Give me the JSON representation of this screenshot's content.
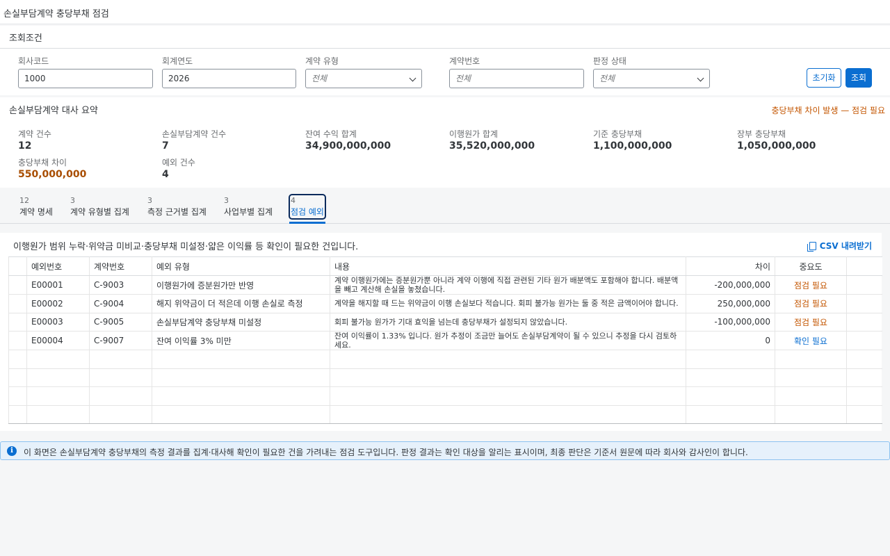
{
  "app": {
    "title": "손실부담계약 충당부채 점검"
  },
  "filters": {
    "title": "조회조건",
    "company": {
      "label": "회사코드",
      "value": "1000"
    },
    "fiscal_year": {
      "label": "회계연도",
      "value": "2026"
    },
    "contract_type": {
      "label": "계약 유형",
      "value": "전체"
    },
    "contract_no": {
      "label": "계약번호",
      "placeholder": "전체"
    },
    "judgment_status": {
      "label": "판정 상태",
      "value": "전체"
    },
    "reset_label": "초기화",
    "search_label": "조회"
  },
  "summary": {
    "title": "손실부담계약 대사 요약",
    "alert": "충당부채 차이 발생 — 점검 필요",
    "kpis": [
      {
        "label": "계약 건수",
        "value": "12"
      },
      {
        "label": "손실부담계약 건수",
        "value": "7"
      },
      {
        "label": "잔여 수익 합계",
        "value": "34,900,000,000"
      },
      {
        "label": "이행원가 합계",
        "value": "35,520,000,000"
      },
      {
        "label": "기준 충당부채",
        "value": "1,100,000,000"
      },
      {
        "label": "장부 충당부채",
        "value": "1,050,000,000"
      },
      {
        "label": "충당부채 차이",
        "value": "550,000,000"
      },
      {
        "label": "예외 건수",
        "value": "4"
      }
    ]
  },
  "tabs": [
    {
      "count": "12",
      "label": "계약 명세"
    },
    {
      "count": "3",
      "label": "계약 유형별 집계"
    },
    {
      "count": "3",
      "label": "측정 근거별 집계"
    },
    {
      "count": "3",
      "label": "사업부별 집계"
    },
    {
      "count": "4",
      "label": "점검 예외"
    }
  ],
  "content": {
    "description": "이행원가 범위 누락·위약금 미비교·충당부채 미설정·얇은 이익률 등 확인이 필요한 건입니다.",
    "csv_label": "CSV 내려받기",
    "columns": [
      "예외번호",
      "계약번호",
      "예외 유형",
      "내용",
      "차이",
      "중요도"
    ],
    "rows": [
      {
        "id": "E00001",
        "contract": "C-9003",
        "type": "이행원가에 증분원가만 반영",
        "detail": "계약 이행원가에는 증분원가뿐 아니라 계약 이행에 직접 관련된 기타 원가 배분액도 포함해야 합니다. 배분액을 빼고 계산해 손실을 놓쳤습니다.",
        "diff": "-200,000,000",
        "severity": "점검 필요"
      },
      {
        "id": "E00002",
        "contract": "C-9004",
        "type": "해지 위약금이 더 적은데 이행 손실로 측정",
        "detail": "계약을 해지할 때 드는 위약금이 이행 손실보다 적습니다. 회피 불가능 원가는 둘 중 적은 금액이어야 합니다.",
        "diff": "250,000,000",
        "severity": "점검 필요"
      },
      {
        "id": "E00003",
        "contract": "C-9005",
        "type": "손실부담계약 충당부채 미설정",
        "detail": "회피 불가능 원가가 기대 효익을 넘는데 충당부채가 설정되지 않았습니다.",
        "diff": "-100,000,000",
        "severity": "점검 필요"
      },
      {
        "id": "E00004",
        "contract": "C-9007",
        "type": "잔여 이익률 3% 미만",
        "detail": "잔여 이익률이 1.33% 입니다. 원가 추정이 조금만 늘어도 손실부담계약이 될 수 있으니 추정을 다시 검토하세요.",
        "diff": "0",
        "severity": "확인 필요"
      }
    ]
  },
  "info": {
    "icon": "info-icon",
    "text": "이 화면은 손실부담계약 충당부채의 측정 결과를 집계·대사해 확인이 필요한 건을 가려내는 점검 도구입니다. 판정 결과는 확인 대상을 알리는 표시이며, 최종 판단은 기준서 원문에 따라 회사와 감사인이 합니다."
  },
  "colors": {
    "accent": "#0a6ed1",
    "warning": "#c35500",
    "warning_value": "#a84d00"
  }
}
